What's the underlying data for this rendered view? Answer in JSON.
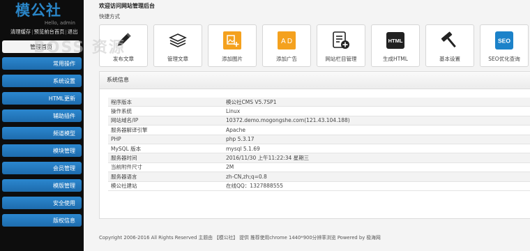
{
  "sidebar": {
    "logo": "模公社",
    "hello": "Hello, admin",
    "links": [
      "清理缓存",
      "预览前台首页",
      "退出"
    ],
    "home": "管理首页",
    "items": [
      "常用操作",
      "系统设置",
      "HTML更新",
      "辅助插件",
      "频道模型",
      "模块管理",
      "会员管理",
      "模版管理",
      "安全使用",
      "版权信息"
    ]
  },
  "main": {
    "welcome": "欢迎访问网站管理后台",
    "quick_title": "快捷方式",
    "shortcuts": [
      {
        "label": "发布文章",
        "icon": "pencil-icon"
      },
      {
        "label": "管理文章",
        "icon": "stack-icon"
      },
      {
        "label": "添加图片",
        "icon": "image-add-icon"
      },
      {
        "label": "添加广告",
        "icon": "ad-icon"
      },
      {
        "label": "网站栏目管理",
        "icon": "list-add-icon"
      },
      {
        "label": "生成HTML",
        "icon": "html-icon"
      },
      {
        "label": "基本设置",
        "icon": "hammer-icon"
      },
      {
        "label": "SEO优化查询",
        "icon": "seo-icon"
      }
    ],
    "icon_texts": {
      "ad": "A D",
      "html": "HTML",
      "seo": "SEO"
    },
    "colors": {
      "accent": "#2a86c8",
      "menu": "#1e6cad",
      "orange": "#f4a11e",
      "dark": "#222222",
      "seo_blue": "#1c82c9"
    },
    "panel_title": "系统信息",
    "info": [
      {
        "k": "程序版本",
        "v": "模公社CMS V5.7SP1"
      },
      {
        "k": "操作系统",
        "v": "Linux"
      },
      {
        "k": "网站域名/IP",
        "v": "10372.demo.mogongshe.com(121.43.104.188)"
      },
      {
        "k": "服务器解译引擎",
        "v": "Apache"
      },
      {
        "k": "PHP",
        "v": "php 5.3.17"
      },
      {
        "k": "MySQL 版本",
        "v": "mysql 5.1.69"
      },
      {
        "k": "服务器时间",
        "v": "2016/11/30 上午11:22:34 星期三"
      },
      {
        "k": "当前附件尺寸",
        "v": "2M"
      },
      {
        "k": "服务器语言",
        "v": "zh-CN,zh;q=0.8"
      },
      {
        "k": "模公社建站",
        "v": "在线QQ：1327888555"
      }
    ],
    "footer": "Copyright 2006-2016 All Rights Reserved 主题由 【模公社】 提供 推荐使用chrome 1440*900分辨率浏览 Powered by 极海网"
  },
  "watermark": "BOSS 资源"
}
